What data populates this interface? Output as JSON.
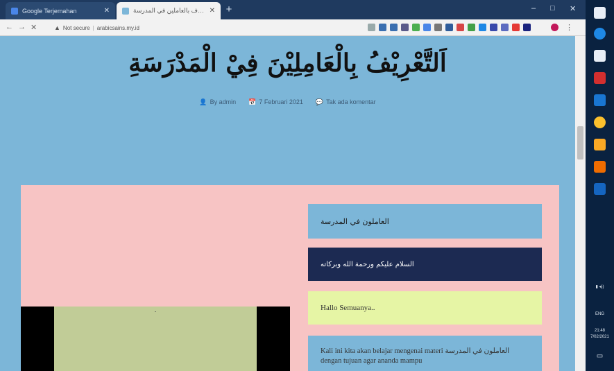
{
  "browser": {
    "tab_inactive_title": "Google Terjemahan",
    "tab_active_title": "التعرف بالعاملين في المدرسة",
    "url_warning": "Not secure",
    "url": "arabicsains.my.id",
    "window_controls": {
      "minimize": "–",
      "maximize": "□",
      "close": "✕"
    }
  },
  "page": {
    "title": "اَلتَّعْرِيْفُ بِالْعَامِلِيْنَ فِيْ الْمَدْرَسَةِ",
    "meta": {
      "author": "By admin",
      "date": "7 Februari 2021",
      "comments": "Tak ada komentar"
    },
    "cards": {
      "card1": "العاملون في المدرسة",
      "card2": "السلام عليكم ورحمة الله وبركاته",
      "card3": "Hallo Semuanya..",
      "card4": "Kali ini kita akan belajar mengenai materi العاملون في المدرسة dengan tujuan agar ananda mampu"
    }
  },
  "taskbar": {
    "time": "21:48",
    "date": "7/02/2021",
    "lang": "ENG"
  },
  "colors": {
    "page_bg": "#7cb6d8",
    "pink_block": "#f7c4c4",
    "dark_card": "#1c2a52",
    "yellow_card": "#e6f5a5",
    "taskbar": "#0a2240"
  }
}
